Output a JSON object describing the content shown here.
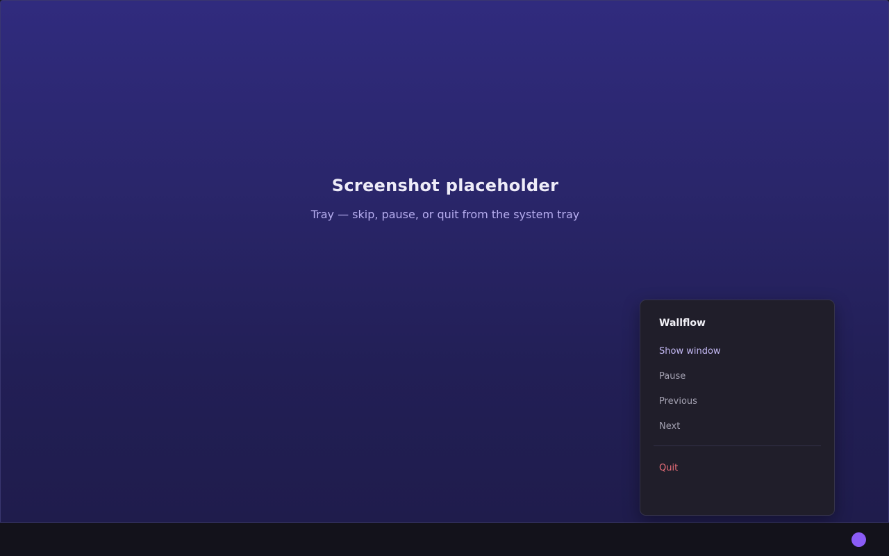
{
  "placeholder": {
    "title": "Screenshot placeholder",
    "subtitle": "Tray — skip, pause, or quit from the system tray"
  },
  "tray_menu": {
    "title": "Wallflow",
    "items": [
      {
        "label": "Show window"
      },
      {
        "label": "Pause"
      },
      {
        "label": "Previous"
      },
      {
        "label": "Next"
      }
    ],
    "quit_label": "Quit"
  },
  "taskbar": {
    "tray_icon": "wallflow-tray-icon"
  },
  "colors": {
    "accent": "#8b5cf6",
    "background_top": "#302b7e",
    "background_bottom": "#1f1c4c",
    "menu_background": "#201e2a",
    "quit": "#ec6f7a",
    "highlight_item": "#c4b9f4"
  }
}
